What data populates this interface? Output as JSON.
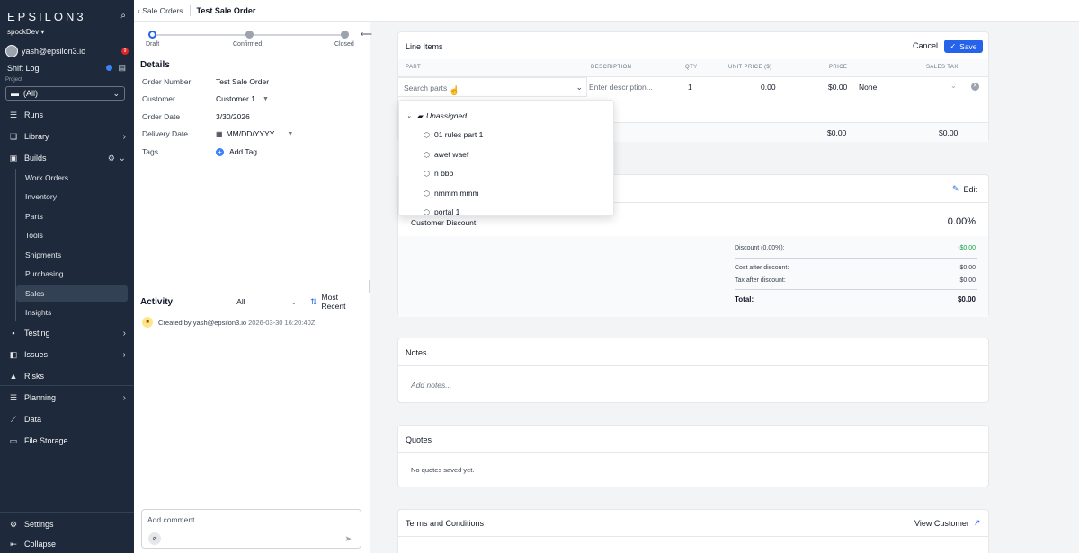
{
  "sidebar": {
    "logo": "EPSILON3",
    "workspace": "spockDev ▾",
    "user_email": "yash@epsilon3.io",
    "notification_count": "9",
    "shift_log": "Shift Log",
    "project_label": "Project",
    "project_value": "(All)",
    "nav": {
      "runs": "Runs",
      "library": "Library",
      "builds": "Builds",
      "testing": "Testing",
      "issues": "Issues",
      "risks": "Risks",
      "planning": "Planning",
      "data": "Data",
      "file_storage": "File Storage",
      "settings": "Settings",
      "collapse": "Collapse"
    },
    "builds_sub": [
      "Work Orders",
      "Inventory",
      "Parts",
      "Tools",
      "Shipments",
      "Purchasing",
      "Sales",
      "Insights"
    ],
    "active_sub": "Sales"
  },
  "topbar": {
    "back_label": "‹ Sale Orders",
    "current": "Test Sale Order"
  },
  "status": {
    "steps": [
      "Draft",
      "Confirmed",
      "Closed"
    ],
    "active_step": "Draft"
  },
  "details": {
    "title": "Details",
    "order_number_label": "Order Number",
    "order_number": "Test Sale Order",
    "customer_label": "Customer",
    "customer": "Customer 1",
    "order_date_label": "Order Date",
    "order_date": "3/30/2026",
    "delivery_date_label": "Delivery Date",
    "delivery_date_placeholder": "MM/DD/YYYY",
    "tags_label": "Tags",
    "add_tag": "Add Tag"
  },
  "activity": {
    "title": "Activity",
    "filter": "All",
    "sort": "Most Recent",
    "entry_text": "Created by yash@epsilon3.io",
    "entry_time": "2026-03-30 16:20:40Z",
    "comment_placeholder": "Add comment"
  },
  "line_items": {
    "title": "Line Items",
    "cancel": "Cancel",
    "save": "Save",
    "columns": [
      "PART",
      "DESCRIPTION",
      "QTY",
      "UNIT PRICE ($)",
      "PRICE",
      "SALES TAX"
    ],
    "part_placeholder": "Search parts",
    "description_placeholder": "Enter description...",
    "qty": "1",
    "unit_price": "0.00",
    "price": "$0.00",
    "sales_tax": "None",
    "total_price": "$0.00",
    "total_tax": "$0.00"
  },
  "part_dropdown": {
    "group": "Unassigned",
    "items": [
      "01 rules part 1",
      "awef waef",
      "n bbb",
      "nmmm mmm",
      "portal 1"
    ]
  },
  "discount": {
    "edit": "Edit",
    "customer_discount_label": "Customer Discount",
    "customer_discount_value": "0.00%",
    "discount_label": "Discount (0.00%):",
    "discount_value": "-$0.00",
    "cost_after_label": "Cost after discount:",
    "cost_after_value": "$0.00",
    "tax_after_label": "Tax after discount:",
    "tax_after_value": "$0.00",
    "total_label": "Total:",
    "total_value": "$0.00"
  },
  "notes": {
    "title": "Notes",
    "placeholder": "Add notes..."
  },
  "quotes": {
    "title": "Quotes",
    "empty": "No quotes saved yet."
  },
  "terms": {
    "title": "Terms and Conditions",
    "view_customer": "View Customer"
  },
  "colors": {
    "sidebar_bg": "#1e2a3b",
    "accent": "#2563eb",
    "green": "#16a34a"
  }
}
